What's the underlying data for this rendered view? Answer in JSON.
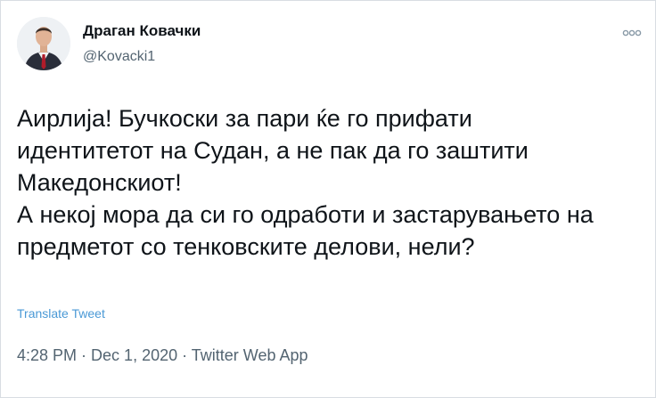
{
  "author": {
    "display_name": "Драган Ковачки",
    "handle": "@Kovacki1",
    "avatar_icon": "profile-photo"
  },
  "more_icon": "more-options-icon",
  "tweet": {
    "lines": [
      "Аирлија! Бучкоски за пари ќе го прифати",
      "идентитетот на Судан, а не пак да го заштити",
      "Македонскиот!",
      "А некој мора да си го одработи и застарувањето на",
      "предметот со тенковските делови, нели?"
    ]
  },
  "translate_label": "Translate Tweet",
  "meta": {
    "time": "4:28 PM",
    "separator": " · ",
    "date": "Dec 1, 2020",
    "source": "Twitter Web App"
  },
  "colors": {
    "text": "#0f1419",
    "secondary": "#536471",
    "link": "#4a99d6"
  }
}
